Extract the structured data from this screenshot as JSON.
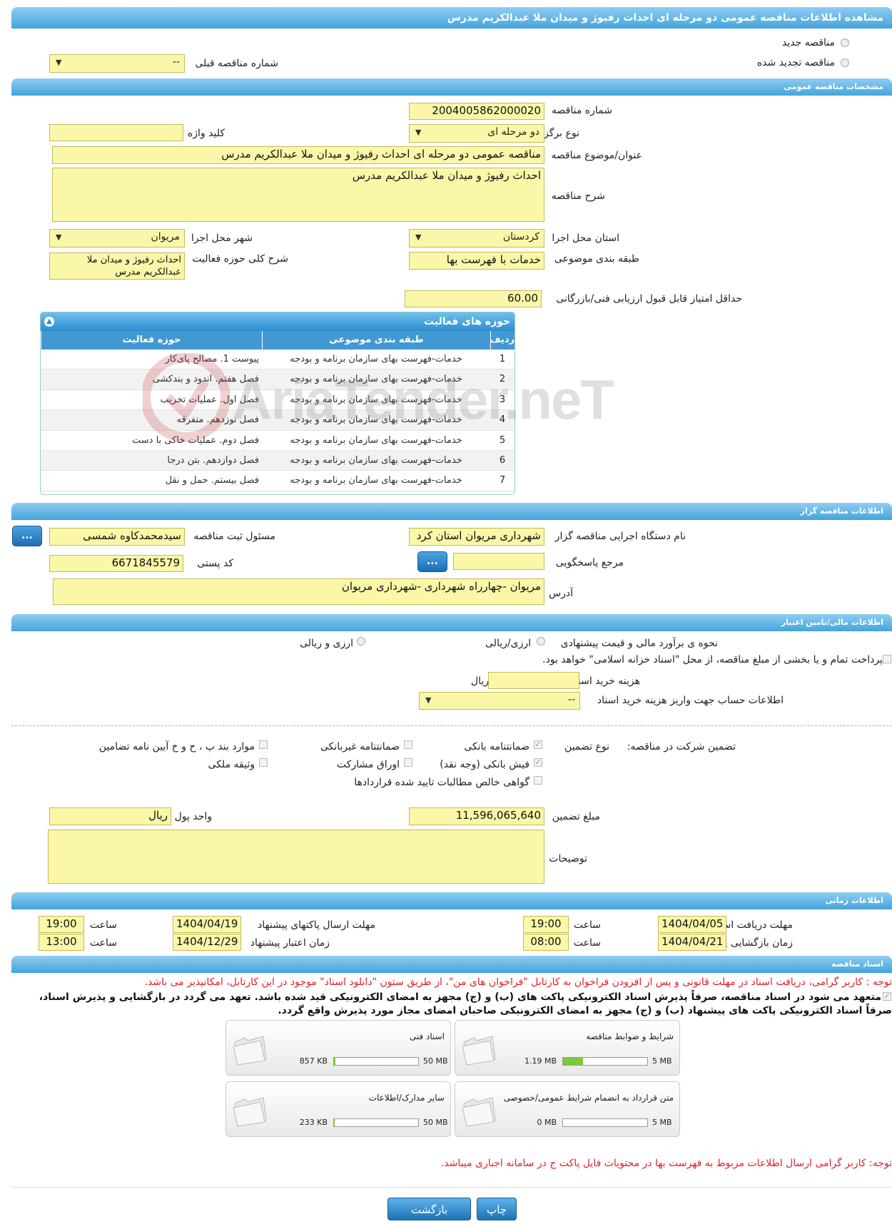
{
  "page_title": "مشاهده اطلاعات مناقصه عمومی دو مرحله ای احداث رفیوژ و میدان ملا عبدالکریم مدرس",
  "top": {
    "new_tender": "مناقصه جدید",
    "renewed_tender": "مناقصه تجدید شده",
    "prev_tender_label": "شماره مناقصه قبلی",
    "prev_tender_value": "--"
  },
  "general": {
    "section_title": "مشخصات مناقصه عمومی",
    "number_label": "شماره مناقصه",
    "number_value": "2004005862000020",
    "type_label": "نوع برگزاری",
    "type_value": "دو مرحله ای",
    "keyword_label": "کلید واژه",
    "keyword_value": "",
    "subject_label": "عنوان/موضوع مناقصه",
    "subject_value": "مناقصه عمومی دو مرحله ای احداث رفیوژ و میدان ملا عبدالکریم مدرس",
    "desc_label": "شرح مناقصه",
    "desc_value": "احداث رفیوژ و میدان ملا عبدالکریم مدرس",
    "province_label": "استان محل اجرا",
    "province_value": "کردستان",
    "city_label": "شهر محل اجرا",
    "city_value": "مریوان",
    "category_label": "طبقه بندی موضوعی",
    "category_value": "خدمات با فهرست بها",
    "activity_desc_label": "شرح کلی حوزه فعالیت",
    "activity_desc_value": "احداث رفیوژ و میدان ملا عبدالکریم مدرس",
    "min_score_label": "حداقل امتیاز قابل قبول ارزیابی فنی/بازرگانی",
    "min_score_value": "60.00"
  },
  "activity_grid": {
    "title": "حوزه های فعالیت",
    "headers": {
      "row": "ردیف",
      "category": "طبقه بندی موضوعی",
      "field": "حوزه فعالیت"
    },
    "rows": [
      {
        "n": "1",
        "category": "خدمات-فهرست بهای سازمان برنامه و بودجه",
        "field": "پیوست 1. مصالح پای‌کار"
      },
      {
        "n": "2",
        "category": "خدمات-فهرست بهای سازمان برنامه و بودجه",
        "field": "فصل هفتم. اندود و بندکشی"
      },
      {
        "n": "3",
        "category": "خدمات-فهرست بهای سازمان برنامه و بودجه",
        "field": "فصل اول. عملیات تخریب"
      },
      {
        "n": "4",
        "category": "خدمات-فهرست بهای سازمان برنامه و بودجه",
        "field": "فصل نوزدهم. متفرقه"
      },
      {
        "n": "5",
        "category": "خدمات-فهرست بهای سازمان برنامه و بودجه",
        "field": "فصل دوم. عملیات خاکی با دست"
      },
      {
        "n": "6",
        "category": "خدمات-فهرست بهای سازمان برنامه و بودجه",
        "field": "فصل دوازدهم. بتن درجا"
      },
      {
        "n": "7",
        "category": "خدمات-فهرست بهای سازمان برنامه و بودجه",
        "field": "فصل بیستم. حمل و نقل"
      }
    ]
  },
  "organizer": {
    "section_title": "اطلاعات مناقصه گزار",
    "org_label": "نام دستگاه اجرایی مناقصه گزار",
    "org_value": "شهرداری مریوان استان کرد",
    "resp_label": "مسئول ثبت مناقصه",
    "resp_value": "سیدمحمدکاوه شمسی",
    "ref_label": "مرجع پاسخگویی",
    "ref_value": "",
    "postal_label": "کد پستی",
    "postal_value": "6671845579",
    "address_label": "آدرس",
    "address_value": "مریوان -چهارراه شهرداری -شهرداری مریوان",
    "dots": "..."
  },
  "finance": {
    "section_title": "اطلاعات مالی/تامین اعتبار",
    "estimate_label": "نحوه ی برآورد مالی و قیمت پیشنهادی",
    "opt_rial": "ارزی/ریالی",
    "opt_fx": "ارزی و ریالی",
    "islamic_note": "پرداخت تمام و یا بخشی از مبلغ مناقصه، از محل \"اسناد خزانه اسلامی\" خواهد بود.",
    "doc_cost_label": "هزینه خرید اسناد",
    "doc_cost_value": "",
    "doc_cost_unit": "ریال",
    "account_label": "اطلاعات حساب جهت واریز هزینه خرید اسناد",
    "account_value": "--"
  },
  "guarantee": {
    "title": "تضمین شرکت در مناقصه:",
    "type_label": "نوع تضمین",
    "bank_guarantee": "ضمانتنامه بانکی",
    "nonbank_guarantee": "ضمانتنامه غیربانکی",
    "other_items": "موارد بند پ ، ح و خ آیین نامه تضامین",
    "cash": "فیش بانکی (وجه نقد)",
    "bonds": "اوراق مشارکت",
    "property": "وثیقه ملکی",
    "claims": "گواهی خالص مطالبات تایید شده قراردادها",
    "amount_label": "مبلغ تضمین",
    "amount_value": "11,596,065,640",
    "currency_label": "واحد پول",
    "currency_value": "ریال",
    "notes_label": "توضیحات",
    "notes_value": ""
  },
  "timing": {
    "section_title": "اطلاعات زمانی",
    "doc_deadline_label": "مهلت دریافت اسناد",
    "doc_deadline_date": "1404/04/05",
    "doc_deadline_time": "19:00",
    "submit_label": "مهلت ارسال پاکتهای پیشنهاد",
    "submit_date": "1404/04/19",
    "submit_time": "19:00",
    "open_label": "زمان بازگشایی پاکت ها",
    "open_date": "1404/04/21",
    "open_time": "08:00",
    "valid_label": "زمان اعتبار پیشنهاد",
    "valid_date": "1404/12/29",
    "valid_time": "13:00",
    "hour_label": "ساعت"
  },
  "documents": {
    "section_title": "اسناد مناقصه",
    "note1": "توجه : کاربر گرامی، دریافت اسناد در مهلت قانونی و پس از افزودن فراخوان به کارتابل \"فراخوان های من\"، از طریق ستون \"دانلود اسناد\" موجود در این کارتابل، امکانپذیر می باشد.",
    "commit1": "متعهد می شود در اسناد مناقصه، صرفاً پذیرش اسناد الکترونیکی پاکت های (ب) و (ج) مجهز به امضای الکترونیکی قید شده باشد. تعهد می گردد در بازگشایی و پذیرش اسناد،",
    "commit2": "صرفاً اسناد الکترونیکی پاکت های پیشنهاد (ب) و (ج) مجهز به امضای الکترونیکی صاحبان امضای مجاز مورد پذیرش واقع گردد.",
    "files": [
      {
        "name": "شرایط و ضوابط مناقصه",
        "used": "1.19 MB",
        "max": "5 MB",
        "ratio": 0.24
      },
      {
        "name": "اسناد فنی",
        "used": "857 KB",
        "max": "50 MB",
        "ratio": 0.017
      },
      {
        "name": "متن قرارداد به انضمام شرایط عمومی/خصوصی",
        "used": "0 MB",
        "max": "5 MB",
        "ratio": 0
      },
      {
        "name": "سایر مدارک/اطلاعات",
        "used": "233 KB",
        "max": "50 MB",
        "ratio": 0.005
      }
    ],
    "note2": "توجه: کاربر گرامی ارسال اطلاعات مربوط به فهرست بها در محتویات فایل پاکت ج در سامانه اجباری میباشد."
  },
  "buttons": {
    "print": "چاپ",
    "back": "بازگشت"
  },
  "watermark": "AriaTender.neT",
  "colors": {
    "header": "#2c8dcd",
    "field": "#fbf7a8",
    "warning": "#e4202a",
    "progress": "#7ec840"
  }
}
